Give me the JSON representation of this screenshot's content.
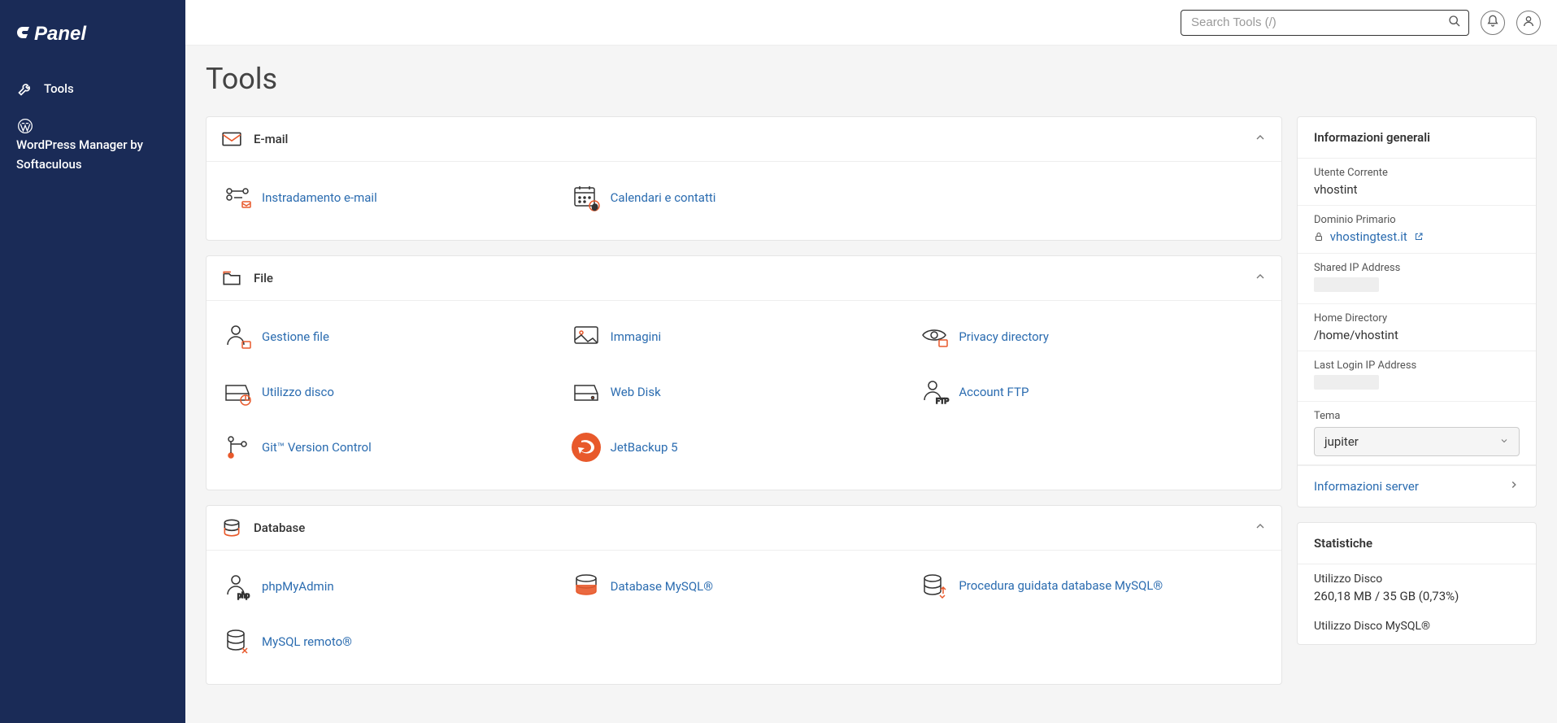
{
  "sidebar": {
    "items": [
      {
        "label": "Tools"
      },
      {
        "label": "WordPress Manager by Softaculous"
      }
    ]
  },
  "search": {
    "placeholder": "Search Tools (/)"
  },
  "page": {
    "title": "Tools"
  },
  "groups": [
    {
      "name": "email",
      "title": "E-mail",
      "tools": [
        {
          "name": "instradamento-email",
          "label": "Instradamento e-mail",
          "icon": "email-routing"
        },
        {
          "name": "calendari-contatti",
          "label": "Calendari e contatti",
          "icon": "calendar"
        }
      ]
    },
    {
      "name": "file",
      "title": "File",
      "tools": [
        {
          "name": "gestione-file",
          "label": "Gestione file",
          "icon": "user-file"
        },
        {
          "name": "immagini",
          "label": "Immagini",
          "icon": "images"
        },
        {
          "name": "privacy-directory",
          "label": "Privacy directory",
          "icon": "privacy"
        },
        {
          "name": "utilizzo-disco",
          "label": "Utilizzo disco",
          "icon": "disk"
        },
        {
          "name": "web-disk",
          "label": "Web Disk",
          "icon": "webdisk"
        },
        {
          "name": "account-ftp",
          "label": "Account FTP",
          "icon": "ftp"
        },
        {
          "name": "git",
          "label": "Git™ Version Control",
          "icon": "git"
        },
        {
          "name": "jetbackup",
          "label": "JetBackup 5",
          "icon": "jetbackup"
        }
      ]
    },
    {
      "name": "database",
      "title": "Database",
      "tools": [
        {
          "name": "phpmyadmin",
          "label": "phpMyAdmin",
          "icon": "phpmyadmin"
        },
        {
          "name": "mysql-db",
          "label": "Database MySQL®",
          "icon": "mysql"
        },
        {
          "name": "mysql-wizard",
          "label": "Procedura guidata database MySQL®",
          "icon": "mysql-wizard"
        },
        {
          "name": "mysql-remote",
          "label": "MySQL remoto®",
          "icon": "mysql-remote"
        }
      ]
    }
  ],
  "info": {
    "title": "Informazioni generali",
    "user_label": "Utente Corrente",
    "user_value": "vhostint",
    "domain_label": "Dominio Primario",
    "domain_value": "vhostingtest.it",
    "ip_label": "Shared IP Address",
    "home_label": "Home Directory",
    "home_value": "/home/vhostint",
    "lastlogin_label": "Last Login IP Address",
    "theme_label": "Tema",
    "theme_value": "jupiter",
    "server_link": "Informazioni server"
  },
  "stats": {
    "title": "Statistiche",
    "disk_label": "Utilizzo Disco",
    "disk_value": "260,18 MB / 35 GB   (0,73%)",
    "mysql_disk_label": "Utilizzo Disco MySQL®"
  }
}
